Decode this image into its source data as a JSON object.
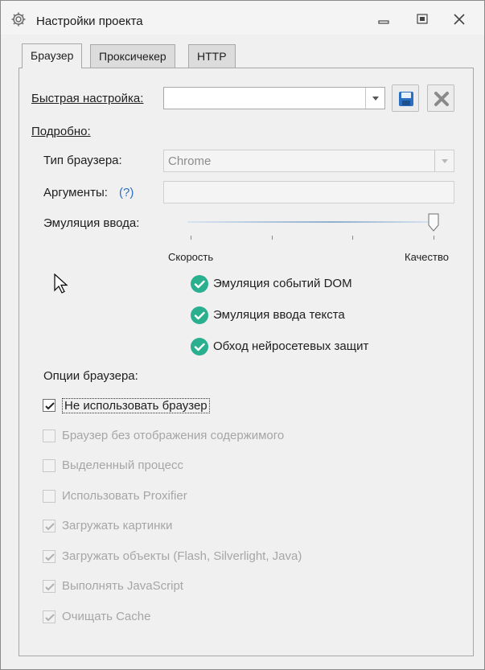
{
  "window": {
    "title": "Настройки проекта"
  },
  "tabs": [
    {
      "label": "Браузер",
      "active": true
    },
    {
      "label": "Проксичекер",
      "active": false
    },
    {
      "label": "HTTP",
      "active": false
    }
  ],
  "quick_setup": {
    "label": "Быстрая настройка:",
    "value": ""
  },
  "details": {
    "label": "Подробно:",
    "browser_type_label": "Тип браузера:",
    "browser_type_value": "Chrome",
    "arguments_label": "Аргументы:",
    "arguments_help": "(?)",
    "arguments_value": "",
    "input_emulation_label": "Эмуляция ввода:",
    "slider_min_label": "Скорость",
    "slider_max_label": "Качество",
    "slider_level": 1.0
  },
  "emulation_features": [
    {
      "label": "Эмуляция событий DOM",
      "enabled": true
    },
    {
      "label": "Эмуляция ввода текста",
      "enabled": true
    },
    {
      "label": "Обход нейросетевых защит",
      "enabled": true
    }
  ],
  "browser_options": {
    "label": "Опции браузера:",
    "items": [
      {
        "label": "Не использовать браузер",
        "checked": true,
        "enabled": true
      },
      {
        "label": "Браузер без отображения содержимого",
        "checked": false,
        "enabled": false
      },
      {
        "label": "Выделенный процесс",
        "checked": false,
        "enabled": false
      },
      {
        "label": "Использовать Proxifier",
        "checked": false,
        "enabled": false
      },
      {
        "label": "Загружать картинки",
        "checked": true,
        "enabled": false
      },
      {
        "label": "Загружать объекты (Flash, Silverlight, Java)",
        "checked": true,
        "enabled": false
      },
      {
        "label": "Выполнять JavaScript",
        "checked": true,
        "enabled": false
      },
      {
        "label": "Очищать Cache",
        "checked": true,
        "enabled": false
      }
    ]
  },
  "icons": {
    "title": "gear-icon",
    "save": "floppy-disk-icon",
    "delete": "x-icon",
    "feature_check": "green-check-circle-icon",
    "cursor": "mouse-pointer-icon"
  },
  "colors": {
    "accent_green": "#2bb08f",
    "help_link": "#2f6fbf",
    "save_icon": "#2a6fc2"
  }
}
